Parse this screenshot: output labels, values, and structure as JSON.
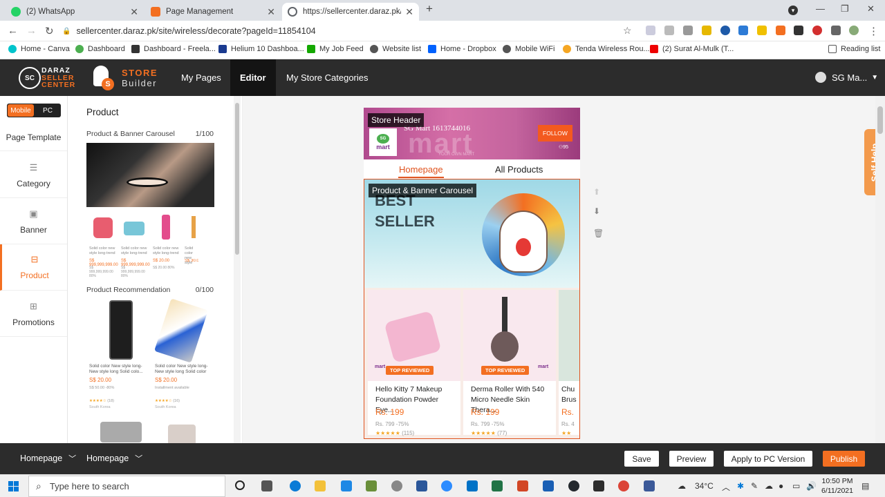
{
  "browser": {
    "tabs": [
      {
        "title": "(2) WhatsApp",
        "color": "#25d366"
      },
      {
        "title": "Page Management",
        "color": "#f36f21"
      },
      {
        "title": "https://sellercenter.daraz.pk/site",
        "color": "#5f6368"
      }
    ],
    "new_tab": "+",
    "url": "sellercenter.daraz.pk/site/wireless/decorate?pageId=11854104",
    "bookmarks": [
      "Home - Canva",
      "Dashboard",
      "Dashboard - Freela...",
      "Helium 10 Dashboa...",
      "My Job Feed",
      "Website list",
      "Home - Dropbox",
      "Mobile WiFi",
      "Tenda Wireless Rou...",
      "(2) Surat Al-Mulk (T..."
    ],
    "reading_list": "Reading list"
  },
  "header": {
    "logo_line1": "DARAZ",
    "logo_line2": "SELLER",
    "logo_line3": "CENTER",
    "builder_line1": "STORE",
    "builder_line2": "Builder",
    "nav": [
      "My Pages",
      "Editor",
      "My Store Categories"
    ],
    "user": "SG Ma..."
  },
  "leftnav": {
    "toggle": [
      "Mobile",
      "PC"
    ],
    "items": [
      "Page Template",
      "Category",
      "Banner",
      "Product",
      "Promotions"
    ]
  },
  "panel": {
    "title": "Product",
    "sections": [
      {
        "label": "Product & Banner Carousel",
        "count": "1/100"
      },
      {
        "label": "Product Recommendation",
        "count": "0/100"
      }
    ],
    "carousel_products": [
      {
        "name": "Solid color new style long-trend",
        "price": "S$ 999,999,999.00",
        "old": "S$ 999,999,999.00 80%"
      },
      {
        "name": "Solid color new style long-trend",
        "price": "S$ 999,999,999.00",
        "old": "S$ 999,999,999.00 80%"
      },
      {
        "name": "Solid color new style long-trend",
        "price": "S$ 20.00",
        "old": "S$ 20.00 80%"
      },
      {
        "name": "Solid color new style",
        "price": "S$ 30.0",
        "old": ""
      }
    ],
    "reco_products": [
      {
        "name": "Solid color New style long-New style long Solid colo...",
        "price": "S$ 20.00",
        "old": "S$ 50.00 -80%",
        "reviews": "(18)",
        "origin": "South Korea"
      },
      {
        "name": "Solid color New style long-New style long Solid color",
        "price": "S$ 20.00",
        "old": "Installment available",
        "reviews": "(16)",
        "origin": "South Korea"
      }
    ]
  },
  "canvas": {
    "store_header_label": "Store Header",
    "store_name": "SG Mart 1613744016",
    "follow": "FOLLOW",
    "followers": "95",
    "banner_word": "mart",
    "banner_sub": "YOUR OWN MART",
    "tabs": [
      "Homepage",
      "All Products"
    ],
    "carousel_label": "Product & Banner Carousel",
    "banner_text": [
      "BEST",
      "SELLER"
    ],
    "badge": "TOP REVIEWED",
    "products": [
      {
        "name": "Hello Kitty 7 Makeup Foundation Powder Eye...",
        "price": "Rs. 199",
        "old": "Rs. 799 -75%",
        "reviews": "(115)"
      },
      {
        "name": "Derma Roller With 540 Micro Needle Skin Thera...",
        "price": "Rs. 199",
        "old": "Rs. 799 -75%",
        "reviews": "(77)"
      },
      {
        "name": "Chu Brus",
        "price": "Rs.",
        "old": "Rs. 4",
        "reviews": ""
      }
    ],
    "self_help": "Self Help"
  },
  "bottombar": {
    "crumbs": [
      "Homepage",
      "Homepage"
    ],
    "buttons": [
      "Save",
      "Preview",
      "Apply to PC Version",
      "Publish"
    ]
  },
  "taskbar": {
    "search_placeholder": "Type here to search",
    "temperature": "34°C",
    "time": "10:50 PM",
    "date": "6/11/2021"
  },
  "colors": {
    "accent": "#f36f21",
    "header_bg": "#2c2c2c",
    "price": "#f36f21"
  }
}
